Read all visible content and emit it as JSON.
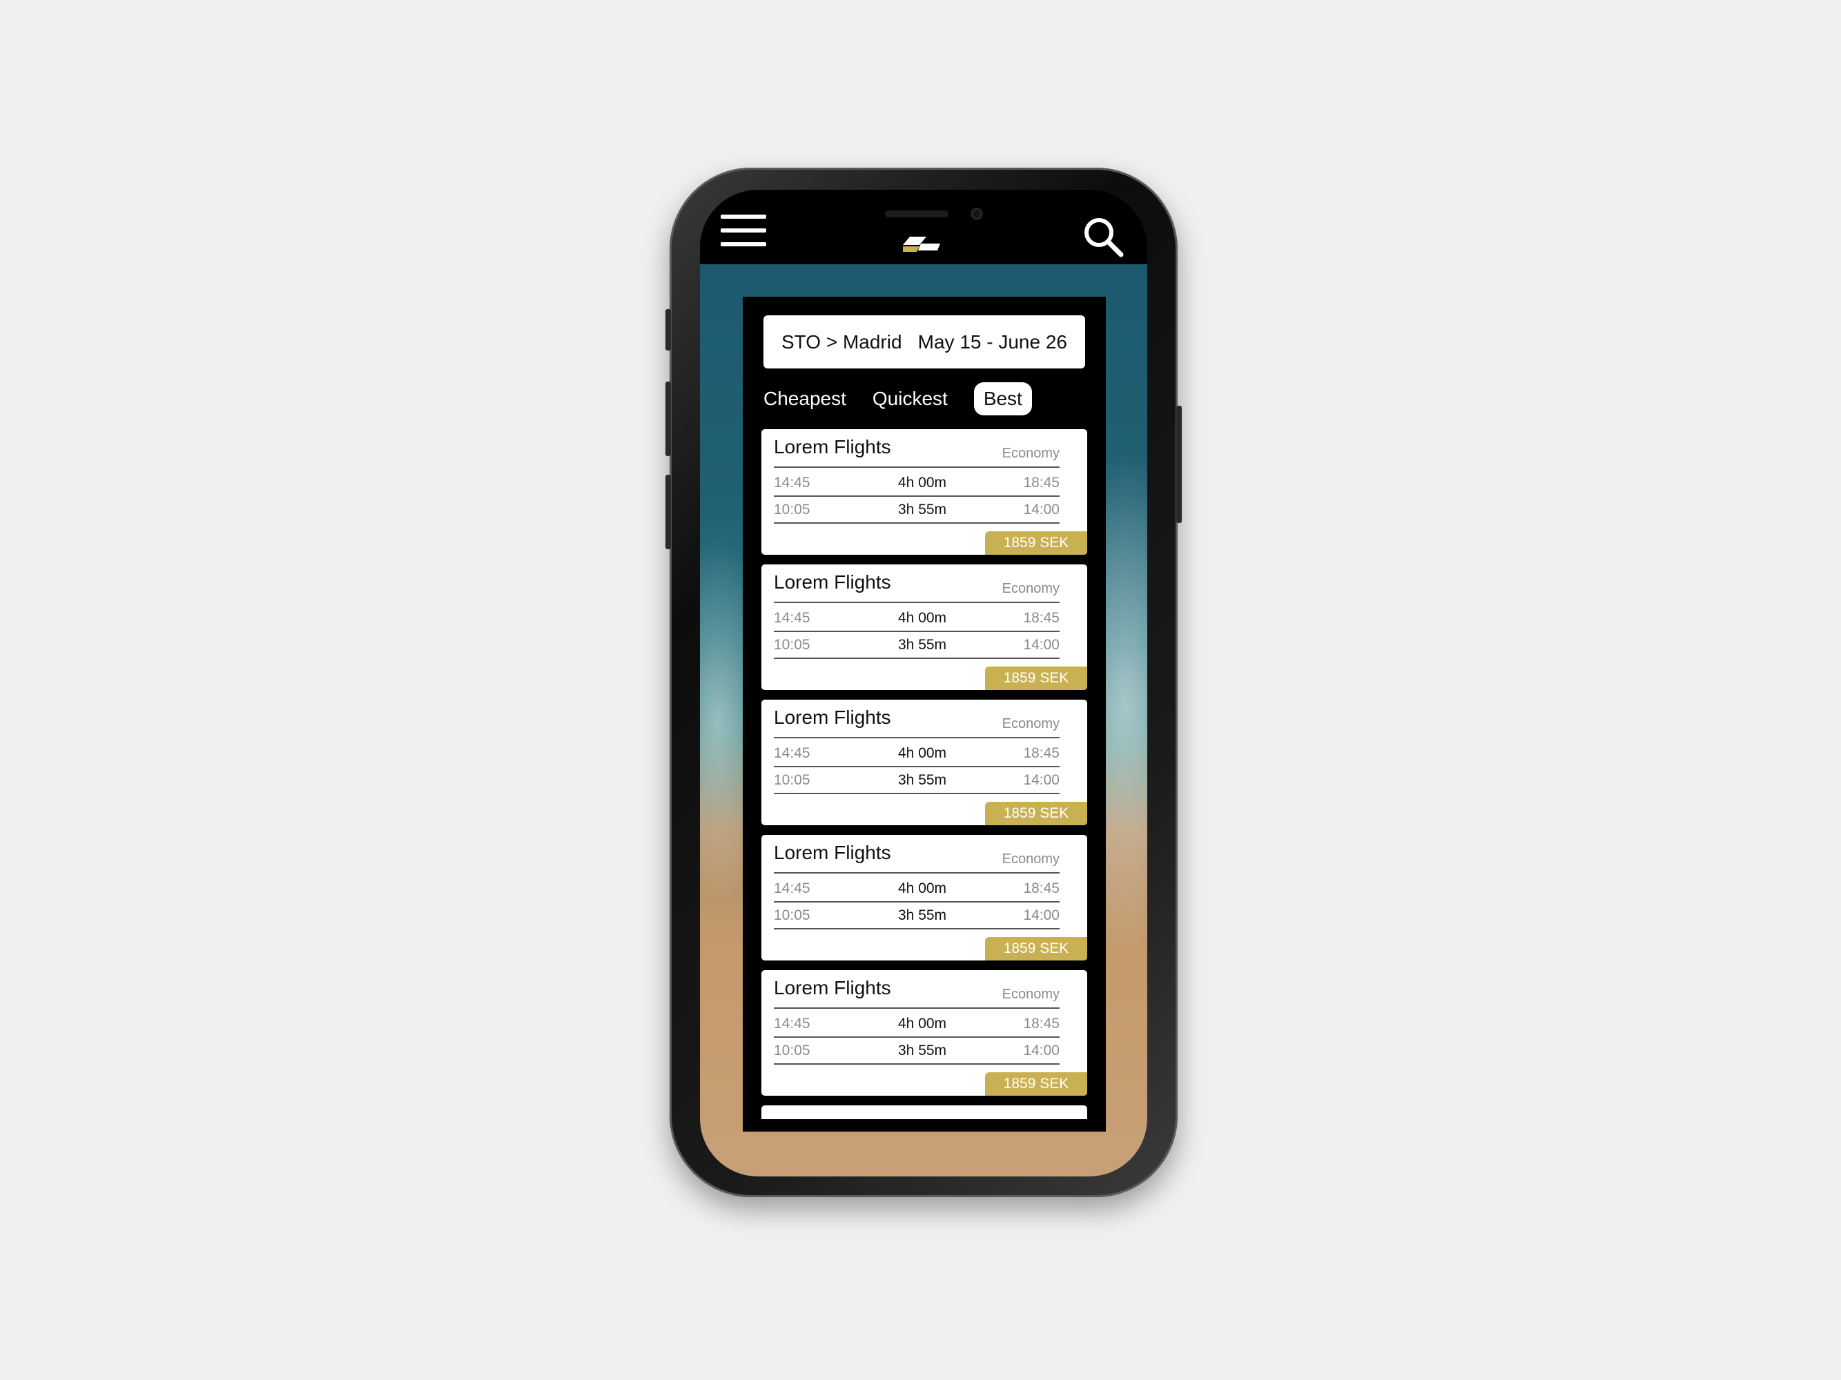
{
  "colors": {
    "background": "#f0f0f0",
    "panel": "#000000",
    "price_badge": "#c9b153",
    "muted_text": "#8a8a8a"
  },
  "header": {
    "menu_icon": "hamburger-menu-icon",
    "logo_icon": "airline-logo-icon",
    "search_icon": "search-icon"
  },
  "search_summary": {
    "route": "STO > Madrid",
    "dates": "May 15 - June 26"
  },
  "sort_tabs": [
    {
      "label": "Cheapest",
      "active": false
    },
    {
      "label": "Quickest",
      "active": false
    },
    {
      "label": "Best",
      "active": true
    }
  ],
  "results": [
    {
      "airline": "Lorem Flights",
      "cabin": "Economy",
      "outbound": {
        "depart": "14:45",
        "duration": "4h 00m",
        "arrive": "18:45"
      },
      "return": {
        "depart": "10:05",
        "duration": "3h 55m",
        "arrive": "14:00"
      },
      "price": "1859 SEK"
    },
    {
      "airline": "Lorem Flights",
      "cabin": "Economy",
      "outbound": {
        "depart": "14:45",
        "duration": "4h 00m",
        "arrive": "18:45"
      },
      "return": {
        "depart": "10:05",
        "duration": "3h 55m",
        "arrive": "14:00"
      },
      "price": "1859 SEK"
    },
    {
      "airline": "Lorem Flights",
      "cabin": "Economy",
      "outbound": {
        "depart": "14:45",
        "duration": "4h 00m",
        "arrive": "18:45"
      },
      "return": {
        "depart": "10:05",
        "duration": "3h 55m",
        "arrive": "14:00"
      },
      "price": "1859 SEK"
    },
    {
      "airline": "Lorem Flights",
      "cabin": "Economy",
      "outbound": {
        "depart": "14:45",
        "duration": "4h 00m",
        "arrive": "18:45"
      },
      "return": {
        "depart": "10:05",
        "duration": "3h 55m",
        "arrive": "14:00"
      },
      "price": "1859 SEK"
    },
    {
      "airline": "Lorem Flights",
      "cabin": "Economy",
      "outbound": {
        "depart": "14:45",
        "duration": "4h 00m",
        "arrive": "18:45"
      },
      "return": {
        "depart": "10:05",
        "duration": "3h 55m",
        "arrive": "14:00"
      },
      "price": "1859 SEK"
    }
  ]
}
